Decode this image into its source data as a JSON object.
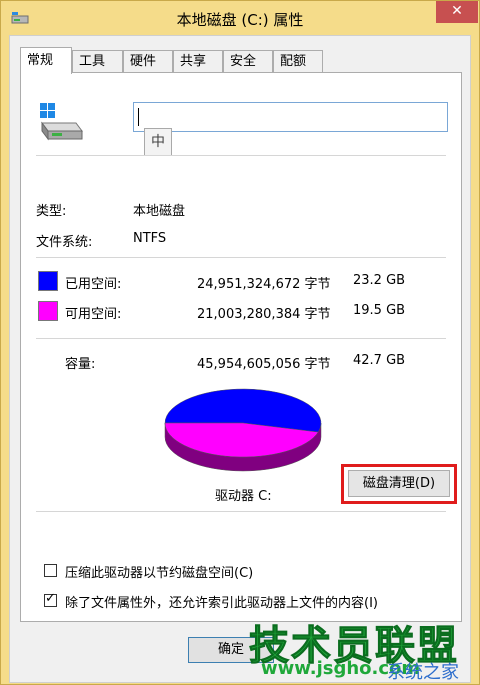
{
  "window": {
    "title": "本地磁盘 (C:) 属性",
    "close_glyph": "✕"
  },
  "tabs": [
    {
      "label": "常规",
      "active": true
    },
    {
      "label": "工具",
      "active": false
    },
    {
      "label": "硬件",
      "active": false
    },
    {
      "label": "共享",
      "active": false
    },
    {
      "label": "安全",
      "active": false
    },
    {
      "label": "配额",
      "active": false
    }
  ],
  "general": {
    "drive_name_value": "",
    "ime_indicator": "中",
    "type_label": "类型:",
    "type_value": "本地磁盘",
    "filesystem_label": "文件系统:",
    "filesystem_value": "NTFS",
    "used": {
      "label": "已用空间:",
      "bytes": "24,951,324,672 字节",
      "size": "23.2 GB",
      "color": "#0000ff"
    },
    "free": {
      "label": "可用空间:",
      "bytes": "21,003,280,384 字节",
      "size": "19.5 GB",
      "color": "#ff00ff"
    },
    "capacity": {
      "label": "容量:",
      "bytes": "45,954,605,056 字节",
      "size": "42.7 GB"
    },
    "usage": {
      "used_fraction": 0.543
    },
    "drive_label": "驱动器 C:",
    "cleanup_button": "磁盘清理(D)",
    "compress_option": {
      "label": "压缩此驱动器以节约磁盘空间(C)",
      "checked": false
    },
    "index_option": {
      "label": "除了文件属性外，还允许索引此驱动器上文件的内容(I)",
      "checked": true
    }
  },
  "buttons": {
    "ok": "确定"
  },
  "watermark": {
    "main": "技术员联盟",
    "url": "www.jsgho.com",
    "suffix": "系统之家"
  }
}
